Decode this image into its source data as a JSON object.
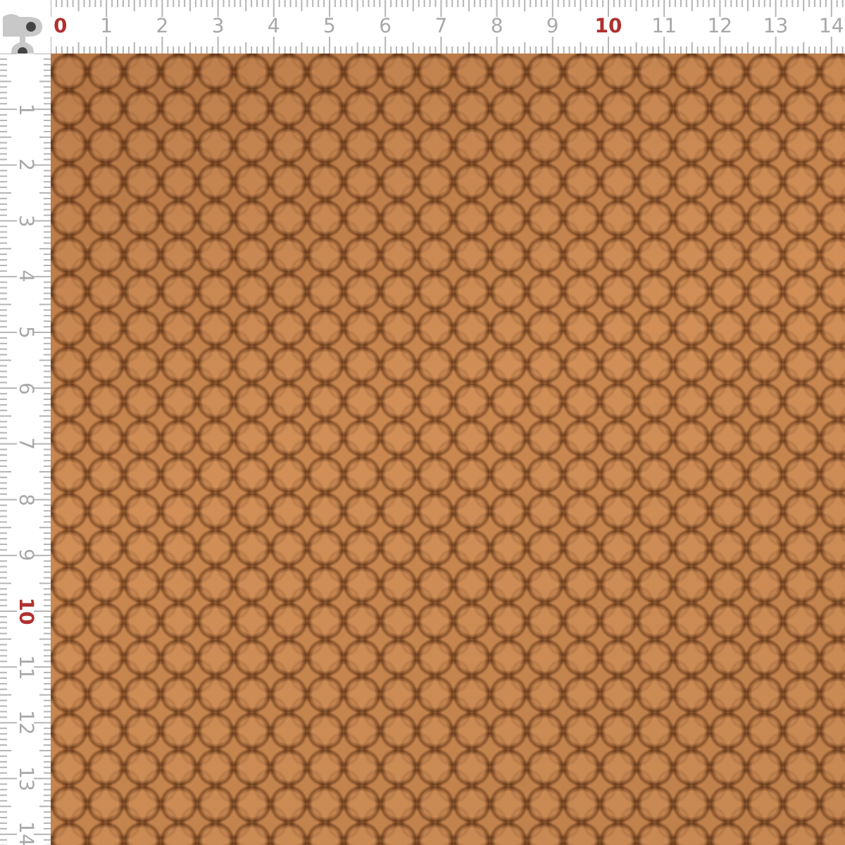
{
  "top_ruler": {
    "labels": [
      {
        "text": "0",
        "highlight": true
      },
      {
        "text": "1",
        "highlight": false
      },
      {
        "text": "2",
        "highlight": false
      },
      {
        "text": "3",
        "highlight": false
      },
      {
        "text": "4",
        "highlight": false
      },
      {
        "text": "5",
        "highlight": false
      },
      {
        "text": "6",
        "highlight": false
      },
      {
        "text": "7",
        "highlight": false
      },
      {
        "text": "8",
        "highlight": false
      },
      {
        "text": "9",
        "highlight": false
      },
      {
        "text": "10",
        "highlight": true
      },
      {
        "text": "11",
        "highlight": false
      },
      {
        "text": "12",
        "highlight": false
      },
      {
        "text": "13",
        "highlight": false
      },
      {
        "text": "14",
        "highlight": false
      }
    ]
  },
  "left_ruler": {
    "labels": [
      {
        "text": "1",
        "highlight": false
      },
      {
        "text": "2",
        "highlight": false
      },
      {
        "text": "3",
        "highlight": false
      },
      {
        "text": "4",
        "highlight": false
      },
      {
        "text": "5",
        "highlight": false
      },
      {
        "text": "6",
        "highlight": false
      },
      {
        "text": "7",
        "highlight": false
      },
      {
        "text": "8",
        "highlight": false
      },
      {
        "text": "9",
        "highlight": false
      },
      {
        "text": "10",
        "highlight": true
      },
      {
        "text": "11",
        "highlight": false
      },
      {
        "text": "12",
        "highlight": false
      },
      {
        "text": "13",
        "highlight": false
      },
      {
        "text": "14",
        "highlight": false
      }
    ]
  }
}
